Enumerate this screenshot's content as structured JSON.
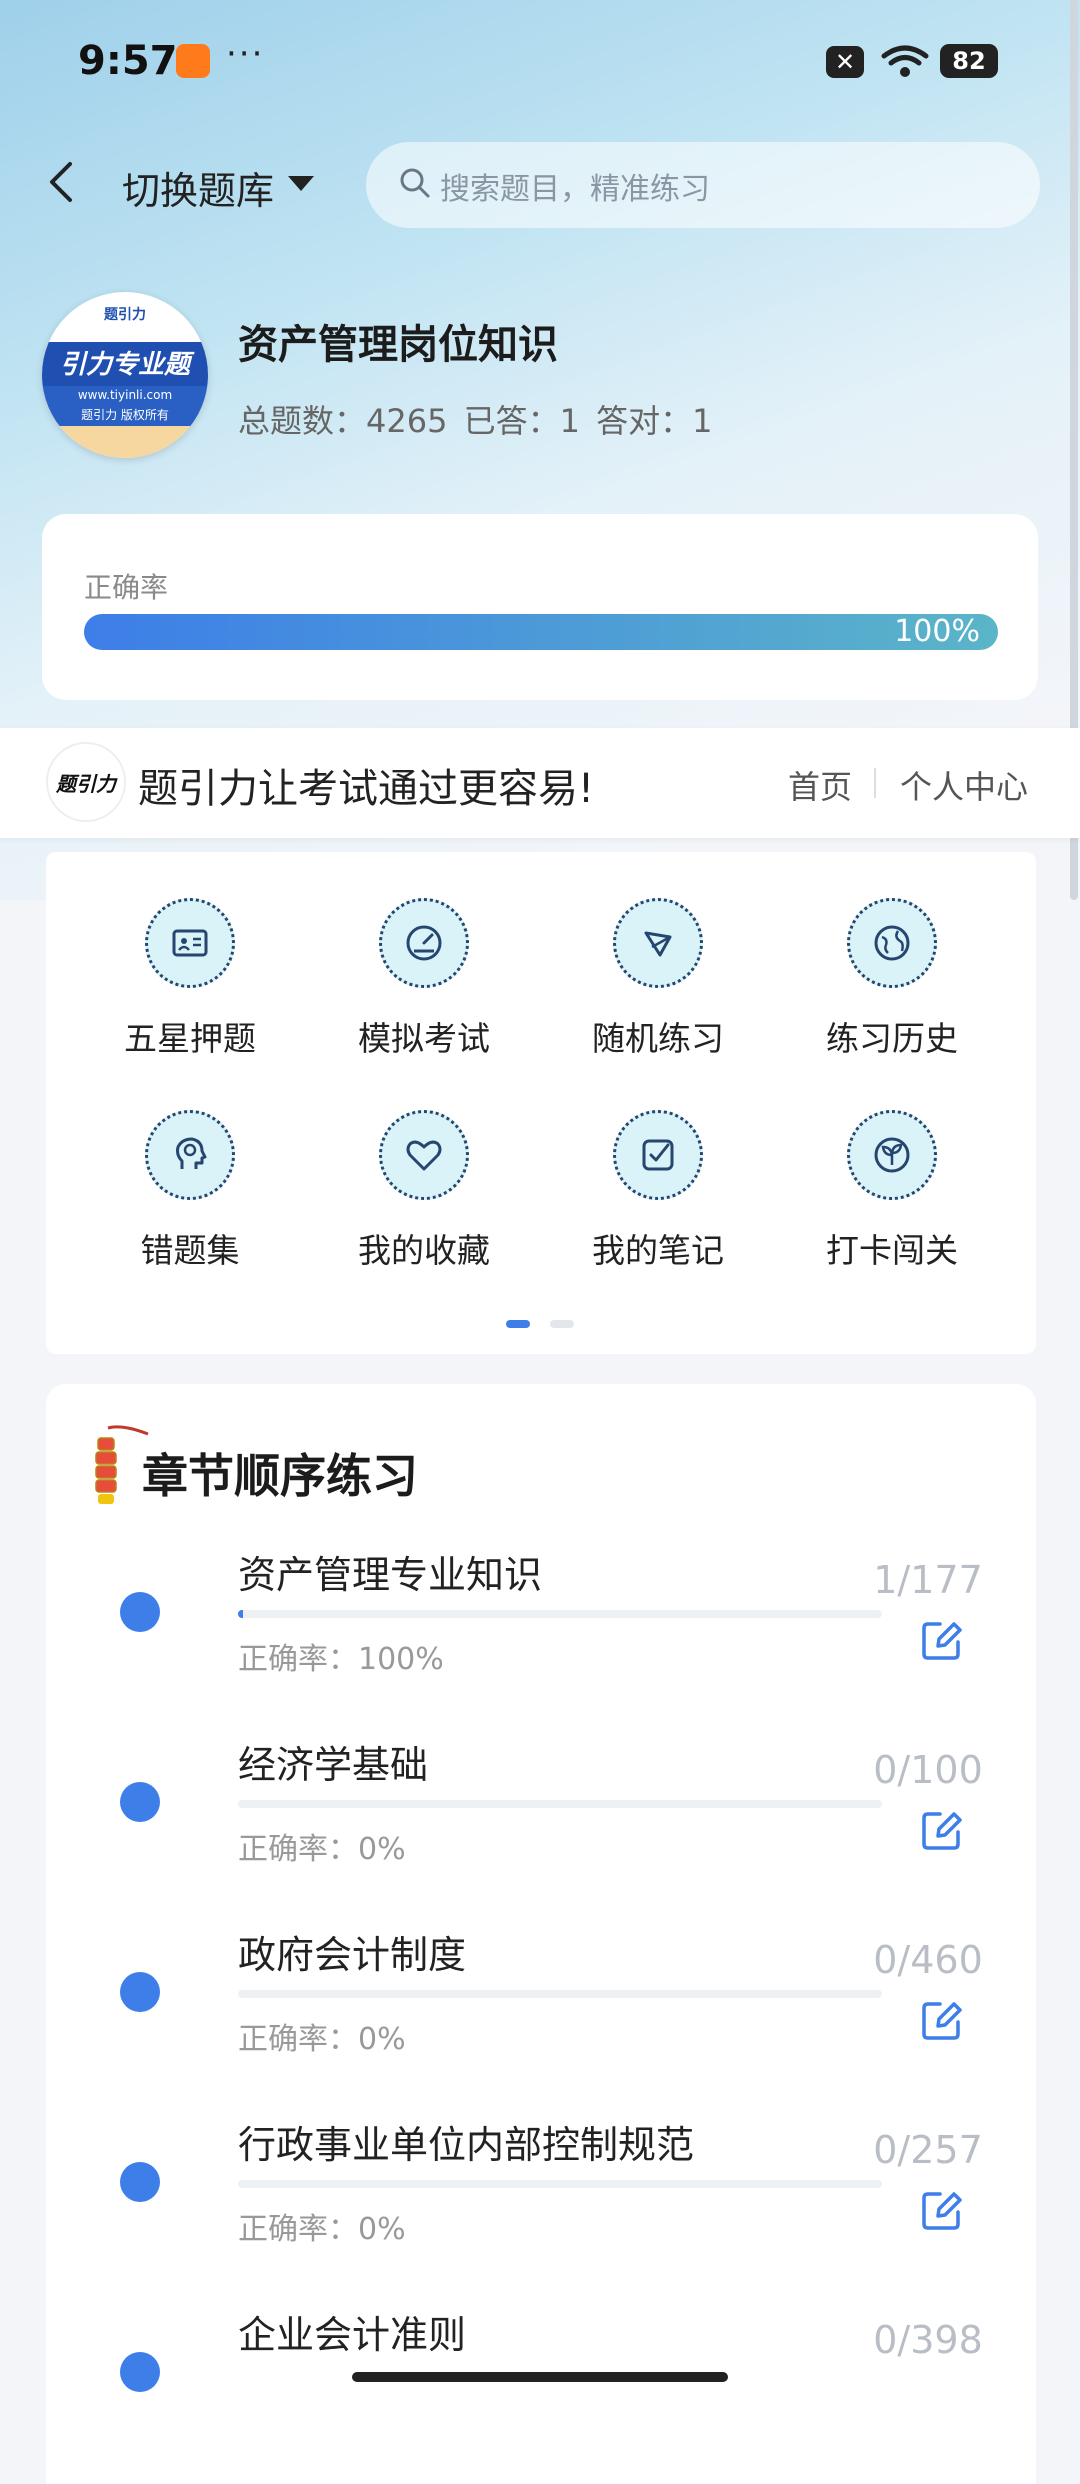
{
  "status_bar": {
    "time": "9:57",
    "dots": "···",
    "battery": "82"
  },
  "header": {
    "switch_label": "切换题库",
    "search_placeholder": "搜索题目，精准练习"
  },
  "bank": {
    "logo_top": "题引力",
    "logo_text": "引力专业题",
    "logo_url": "www.tiyinli.com",
    "logo_copy": "题引力 版权所有",
    "title": "资产管理岗位知识",
    "stats": "总题数：4265   已答：1   答对：1"
  },
  "accuracy": {
    "label": "正确率",
    "percent_text": "100%",
    "value": 1.0
  },
  "slogan_strip": {
    "logo_text": "题引力",
    "slogan": "题引力让考试通过更容易!",
    "nav_home": "首页",
    "nav_personal": "个人中心"
  },
  "features": [
    {
      "label": "五星押题",
      "icon": "id-card-icon"
    },
    {
      "label": "模拟考试",
      "icon": "gauge-icon"
    },
    {
      "label": "随机练习",
      "icon": "shuffle-icon"
    },
    {
      "label": "练习历史",
      "icon": "globe-icon"
    },
    {
      "label": "错题集",
      "icon": "head-icon"
    },
    {
      "label": "我的收藏",
      "icon": "heart-icon"
    },
    {
      "label": "我的笔记",
      "icon": "note-check-icon"
    },
    {
      "label": "打卡闯关",
      "icon": "sprout-icon"
    }
  ],
  "pager": {
    "pages": 2,
    "active": 0
  },
  "chapters": {
    "title": "章节顺序练习",
    "items": [
      {
        "name": "资产管理专业知识",
        "accuracy": "正确率：100%",
        "count": "1/177",
        "progress": 0.0056
      },
      {
        "name": "经济学基础",
        "accuracy": "正确率：0%",
        "count": "0/100",
        "progress": 0
      },
      {
        "name": "政府会计制度",
        "accuracy": "正确率：0%",
        "count": "0/460",
        "progress": 0
      },
      {
        "name": "行政事业单位内部控制规范",
        "accuracy": "正确率：0%",
        "count": "0/257",
        "progress": 0
      },
      {
        "name": "企业会计准则",
        "accuracy": "",
        "count": "0/398",
        "progress": 0
      }
    ]
  },
  "colors": {
    "accent": "#3d7ee8",
    "icon_bg": "#d9f3f8",
    "icon_stroke": "#26466f"
  }
}
